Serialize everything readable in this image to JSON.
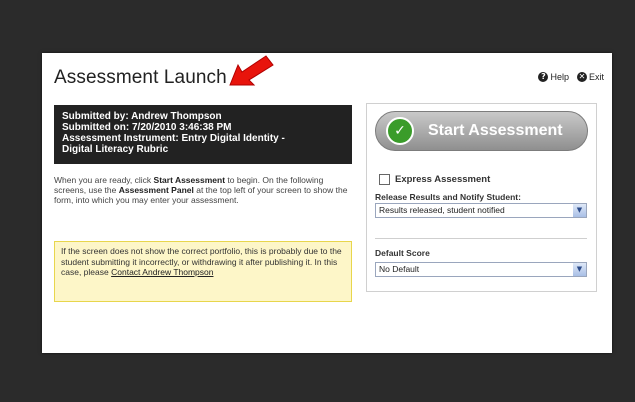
{
  "dialog": {
    "title": "Assessment Launch",
    "help_label": "Help",
    "exit_label": "Exit"
  },
  "info": {
    "submitted_by": "Submitted by: Andrew Thompson",
    "submitted_on": "Submitted on: 7/20/2010 3:46:38 PM",
    "instrument_line1": "Assessment Instrument: Entry Digital Identity -",
    "instrument_line2": "Digital Literacy Rubric"
  },
  "intro": {
    "part1": "When you are ready, click ",
    "bold1": "Start Assessment",
    "part2": " to begin. On the following screens, use the ",
    "bold2": "Assessment Panel",
    "part3": " at the top left of your screen to show the form, into which you may enter your assessment."
  },
  "warning": {
    "text": "If the screen does not show the correct portfolio, this is probably due to the student submitting it incorrectly, or withdrawing it after publishing it. In this case, please",
    "link": "Contact Andrew Thompson"
  },
  "panel": {
    "start_button": "Start Assessment",
    "express_label": "Express Assessment",
    "release_label": "Release Results and Notify Student:",
    "release_value": "Results released, student notified",
    "default_score_label": "Default Score",
    "default_score_value": "No Default"
  },
  "colors": {
    "accent_green": "#3a9c2a",
    "arrow_red": "#e8140c",
    "warning_bg": "#fdf6c8"
  }
}
